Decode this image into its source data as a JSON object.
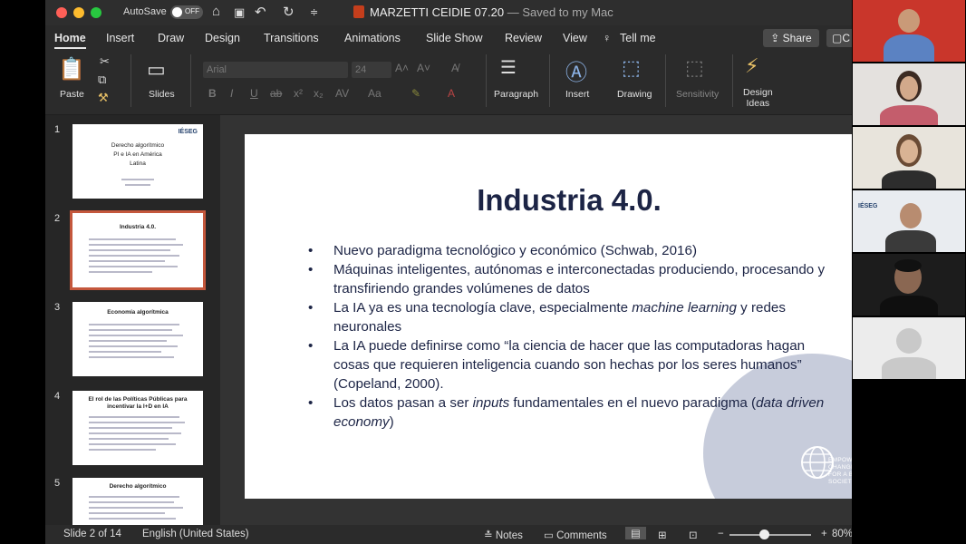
{
  "window": {
    "autosave_label": "AutoSave",
    "autosave_state": "OFF",
    "doc_name": "MARZETTI CEIDIE 07.20",
    "saved_status": "— Saved to my Mac",
    "icons": [
      "home-icon",
      "save-icon",
      "undo-icon",
      "redo-icon",
      "customize-icon"
    ]
  },
  "tabs": [
    "Home",
    "Insert",
    "Draw",
    "Design",
    "Transitions",
    "Animations",
    "Slide Show",
    "Review",
    "View"
  ],
  "tell_me": "Tell me",
  "share_label": "Share",
  "comment_label": "C",
  "ribbon": {
    "paste": "Paste",
    "slides": "Slides",
    "font_name": "Arial",
    "font_size": "24",
    "paragraph": "Paragraph",
    "insert": "Insert",
    "drawing": "Drawing",
    "sensitivity": "Sensitivity",
    "design_ideas_line1": "Design",
    "design_ideas_line2": "Ideas"
  },
  "thumbnails": [
    {
      "num": "1",
      "title_lines": [
        "Derecho algorítmico",
        "PI e IA en América",
        "Latina"
      ],
      "logo": "IÉSEG"
    },
    {
      "num": "2",
      "title_lines": [
        "Industria 4.0."
      ],
      "logo": ""
    },
    {
      "num": "3",
      "title_lines": [
        "Economía algorítmica"
      ],
      "logo": ""
    },
    {
      "num": "4",
      "title_lines": [
        "El rol de las Políticas Públicas para",
        "incentivar la I+D en IA"
      ],
      "logo": ""
    },
    {
      "num": "5",
      "title_lines": [
        "Derecho algorítmico"
      ],
      "logo": ""
    }
  ],
  "slide": {
    "title": "Industria 4.0.",
    "bullets": [
      {
        "parts": [
          {
            "t": "Nuevo paradigma tecnológico y económico (Schwab, 2016)",
            "i": false
          }
        ]
      },
      {
        "parts": [
          {
            "t": "Máquinas inteligentes, autónomas e interconectadas produciendo, procesando y transfiriendo grandes volúmenes de datos",
            "i": false
          }
        ]
      },
      {
        "parts": [
          {
            "t": "La IA ya es una tecnología clave, especialmente ",
            "i": false
          },
          {
            "t": "machine learning",
            "i": true
          },
          {
            "t": " y redes neuronales",
            "i": false
          }
        ]
      },
      {
        "parts": [
          {
            "t": "La IA puede definirse como “la ciencia de hacer que las computadoras hagan cosas que requieren inteligencia cuando son hechas por los seres humanos” (Copeland, 2000).",
            "i": false
          }
        ]
      },
      {
        "parts": [
          {
            "t": "Los datos pasan a ser ",
            "i": false
          },
          {
            "t": "inputs",
            "i": true
          },
          {
            "t": " fundamentales en el nuevo paradigma (",
            "i": false
          },
          {
            "t": "data driven economy",
            "i": true
          },
          {
            "t": ")",
            "i": false
          }
        ]
      }
    ],
    "footer_logo_text": "EMPOWERING CHANGEMAKERS FOR A BETTER SOCIETY"
  },
  "status": {
    "slide_info": "Slide 2 of 14",
    "language": "English (United States)",
    "notes": "Notes",
    "comments": "Comments",
    "zoom": "80%"
  },
  "colors": {
    "slide_title": "#1c2445",
    "selected_thumb": "#c4573c",
    "ppt_red": "#c43e1c"
  }
}
